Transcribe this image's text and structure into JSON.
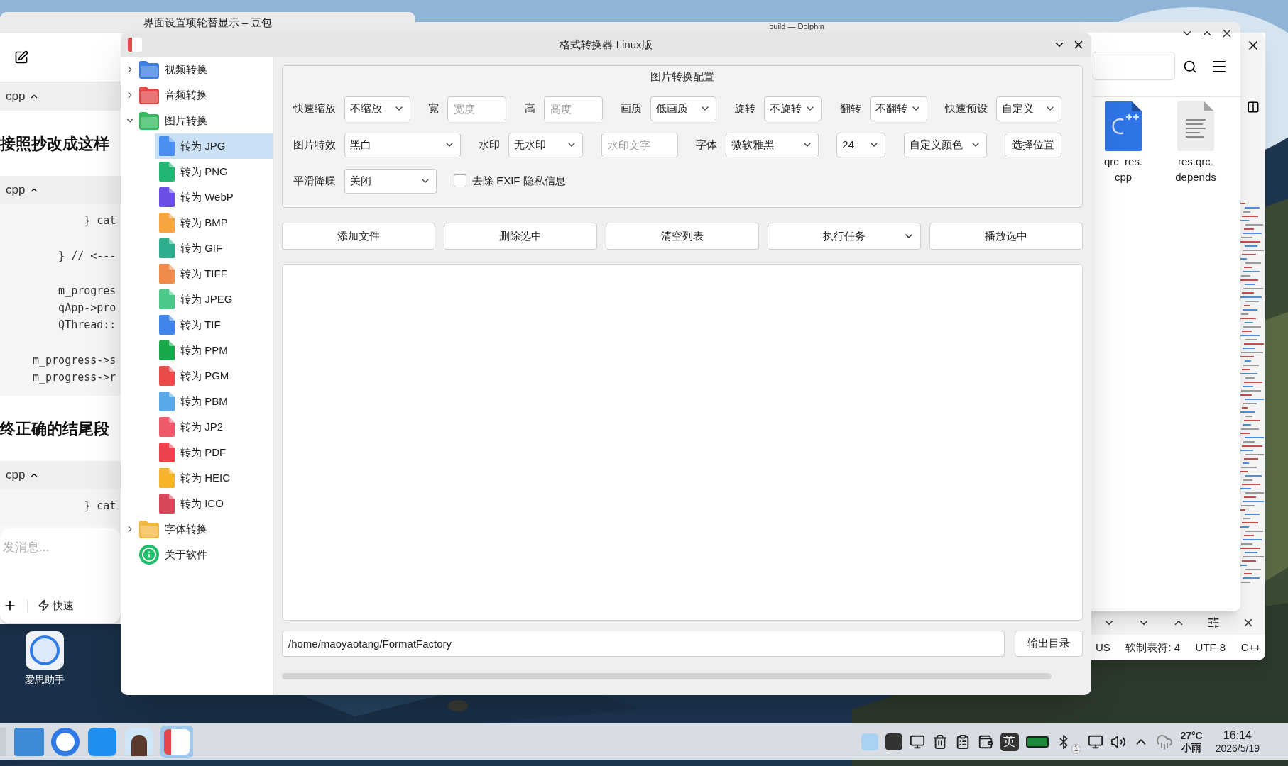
{
  "chat_window": {
    "title": "界面设置项轮替显示 – 豆包",
    "blocks": [
      {
        "kind": "code_header",
        "text": "cpp"
      },
      {
        "kind": "heading",
        "text": "接照抄改成这样"
      },
      {
        "kind": "code_header",
        "text": "cpp"
      },
      {
        "kind": "code",
        "lines": [
          "        } cat",
          "    } // <---",
          "    m_progres",
          "    qApp->pro",
          "    QThread::",
          "m_progress->s",
          "m_progress->r"
        ]
      },
      {
        "kind": "heading",
        "text": "终正确的结尾段"
      },
      {
        "kind": "code_header",
        "text": "cpp"
      },
      {
        "kind": "code",
        "lines": [
          "        } cat"
        ]
      }
    ],
    "message_placeholder": "发消息...",
    "quick_button": "快速"
  },
  "file_manager": {
    "title": "build — Dolphin",
    "files": [
      {
        "name": "qrc_res.\ncpp",
        "kind": "cpp"
      },
      {
        "name": "res.qrc.\ndepends",
        "kind": "text"
      }
    ]
  },
  "editor": {
    "status": [
      "US",
      "软制表符: 4",
      "UTF-8",
      "C++"
    ]
  },
  "desktop_icon": {
    "label": "爱思助手"
  },
  "app_window": {
    "title": "格式转换器 Linux版",
    "tree": [
      {
        "label": "视频转换",
        "kind": "video",
        "expanded": false,
        "selected": false
      },
      {
        "label": "音频转换",
        "kind": "audio",
        "expanded": false,
        "selected": false
      },
      {
        "label": "图片转换",
        "expanded": true,
        "selected": false,
        "children": [
          {
            "label": "转为 JPG",
            "color": "#4a8ef0",
            "selected": true
          },
          {
            "label": "转为 PNG",
            "color": "#22b573",
            "selected": false
          },
          {
            "label": "转为 WebP",
            "color": "#6b4ee6",
            "selected": false
          },
          {
            "label": "转为 BMP",
            "color": "#f7a540",
            "selected": false
          },
          {
            "label": "转为 GIF",
            "color": "#2fae8f",
            "selected": false
          },
          {
            "label": "转为 TIFF",
            "color": "#f08a4b",
            "selected": false
          },
          {
            "label": "转为 JPEG",
            "color": "#4cc98a",
            "selected": false
          },
          {
            "label": "转为 TIF",
            "color": "#3f86e8",
            "selected": false
          },
          {
            "label": "转为 PPM",
            "color": "#19a84a",
            "selected": false
          },
          {
            "label": "转为 PGM",
            "color": "#e94b4b",
            "selected": false
          },
          {
            "label": "转为 PBM",
            "color": "#5aa9e6",
            "selected": false
          },
          {
            "label": "转为 JP2",
            "color": "#ef5a6a",
            "selected": false
          },
          {
            "label": "转为 PDF",
            "color": "#f0424d",
            "selected": false
          },
          {
            "label": "转为 HEIC",
            "color": "#f6b42c",
            "selected": false
          },
          {
            "label": "转为 ICO",
            "color": "#d9485a",
            "selected": false
          }
        ]
      },
      {
        "label": "字体转换",
        "kind": "font",
        "expanded": false,
        "selected": false
      },
      {
        "label": "关于软件",
        "kind": "info",
        "selected": false
      }
    ],
    "config": {
      "title": "图片转换配置",
      "rows": [
        {
          "fields": [
            {
              "label": "快速缩放",
              "kind": "select",
              "value": "不缩放"
            },
            {
              "label": "宽",
              "kind": "input",
              "placeholder": "宽度"
            },
            {
              "label": "高",
              "kind": "input",
              "placeholder": "高度"
            },
            {
              "label": "画质",
              "kind": "select",
              "value": "低画质"
            },
            {
              "label": "旋转",
              "kind": "select",
              "value": "不旋转"
            },
            {
              "label": "翻转",
              "kind": "select",
              "value": "不翻转"
            },
            {
              "label": "快速预设",
              "kind": "select",
              "value": "自定义"
            }
          ]
        },
        {
          "fields": [
            {
              "label": "图片特效",
              "kind": "select",
              "value": "黑白"
            },
            {
              "label": "水印",
              "kind": "select",
              "value": "无水印"
            },
            {
              "kind": "input",
              "placeholder": "水印文字"
            },
            {
              "label": "字体",
              "kind": "select",
              "value": "微软雅黑"
            },
            {
              "kind": "select",
              "value": "24"
            },
            {
              "kind": "select",
              "value": "自定义颜色"
            },
            {
              "kind": "button",
              "value": "选择位置"
            }
          ]
        },
        {
          "fields": [
            {
              "label": "平滑降噪",
              "kind": "select",
              "value": "关闭"
            },
            {
              "kind": "checkbox",
              "value": "去除 EXIF 隐私信息",
              "checked": false
            }
          ]
        }
      ]
    },
    "actions": [
      {
        "label": "添加文件",
        "kind": "button"
      },
      {
        "label": "删除选中",
        "kind": "button"
      },
      {
        "label": "清空列表",
        "kind": "button"
      },
      {
        "label": "执行任务",
        "kind": "menu"
      },
      {
        "label": "播放选中",
        "kind": "button"
      }
    ],
    "output": {
      "value": "/home/maoyaotang/FormatFactory",
      "button": "输出目录"
    },
    "progress": {
      "level": 0
    }
  },
  "taskbar": {
    "tray_language": "英",
    "bluetooth_badge": "1",
    "temperature": "27°C",
    "weather": "小雨",
    "time": "16:14",
    "date": "2026/5/19"
  }
}
